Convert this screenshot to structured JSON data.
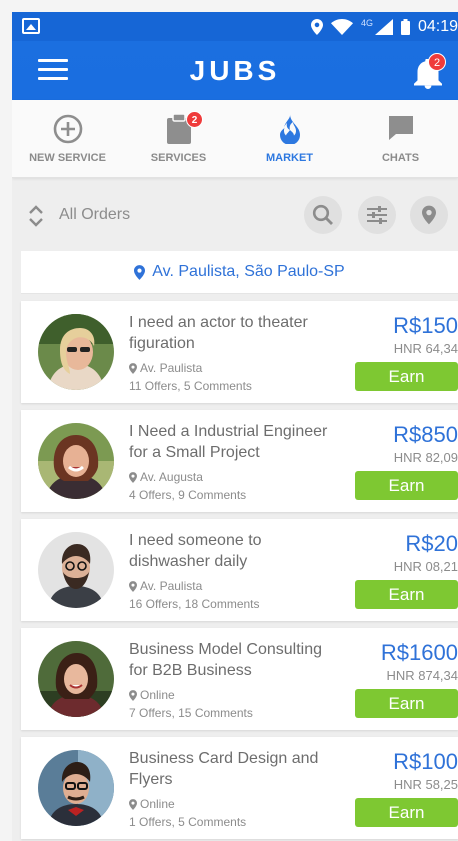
{
  "status_bar": {
    "network": "4G",
    "time": "04:19"
  },
  "app": {
    "title": "JUBS",
    "notification_count": "2"
  },
  "tabs": [
    {
      "label": "NEW SERVICE",
      "icon": "plus-circle-icon"
    },
    {
      "label": "SERVICES",
      "icon": "clipboard-icon",
      "badge": "2"
    },
    {
      "label": "MARKET",
      "icon": "flame-icon",
      "active": true
    },
    {
      "label": "CHATS",
      "icon": "chat-bubble-icon"
    }
  ],
  "filter": {
    "label": "All Orders"
  },
  "location": {
    "label": "Av. Paulista, São Paulo-SP"
  },
  "orders": [
    {
      "title": "I need an actor to theater figuration",
      "location": "Av. Paulista",
      "meta": "11 Offers, 5 Comments",
      "price": "R$150",
      "hnr": "HNR 64,34",
      "action": "Earn"
    },
    {
      "title": "I Need a Industrial Engineer for a Small Project",
      "location": "Av. Augusta",
      "meta": "4 Offers, 9 Comments",
      "price": "R$850",
      "hnr": "HNR 82,09",
      "action": "Earn"
    },
    {
      "title": "I need someone to dishwasher daily",
      "location": "Av. Paulista",
      "meta": "16 Offers, 18 Comments",
      "price": "R$20",
      "hnr": "HNR 08,21",
      "action": "Earn"
    },
    {
      "title": "Business Model Consulting for B2B Business",
      "location": "Online",
      "meta": "7 Offers, 15 Comments",
      "price": "R$1600",
      "hnr": "HNR 874,34",
      "action": "Earn"
    },
    {
      "title": "Business Card Design and Flyers",
      "location": "Online",
      "meta": "1 Offers, 5 Comments",
      "price": "R$100",
      "hnr": "HNR 58,25",
      "action": "Earn"
    }
  ],
  "colors": {
    "primary": "#1a6ee0",
    "accent_blue": "#2f72d8",
    "earn_green": "#7ec832",
    "badge_red": "#ef3b3b"
  }
}
